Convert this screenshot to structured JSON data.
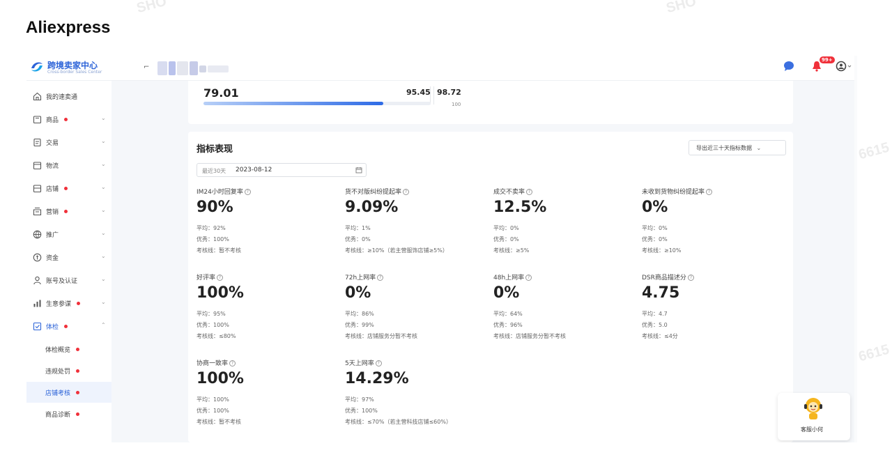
{
  "page": {
    "title": "Aliexpress"
  },
  "watermarks": [
    "SHO",
    "SHO",
    "6615",
    "6615"
  ],
  "topbar": {
    "logo_text": "跨境卖家中心",
    "logo_sub": "Cross-border Sales Center",
    "notification_badge": "99+"
  },
  "sidebar": {
    "items": [
      {
        "label": "我的速卖通",
        "dot": false,
        "chevron": ""
      },
      {
        "label": "商品",
        "dot": true,
        "chevron": "⌄"
      },
      {
        "label": "交易",
        "dot": false,
        "chevron": "⌄"
      },
      {
        "label": "物流",
        "dot": false,
        "chevron": "⌄"
      },
      {
        "label": "店铺",
        "dot": true,
        "chevron": "⌄"
      },
      {
        "label": "营销",
        "dot": true,
        "chevron": "⌄"
      },
      {
        "label": "推广",
        "dot": false,
        "chevron": "⌄"
      },
      {
        "label": "资金",
        "dot": false,
        "chevron": "⌄"
      },
      {
        "label": "账号及认证",
        "dot": false,
        "chevron": "⌄"
      },
      {
        "label": "生意参谋",
        "dot": true,
        "chevron": "⌄"
      },
      {
        "label": "体检",
        "dot": true,
        "chevron": "⌃"
      }
    ],
    "sub_items": [
      {
        "label": "体检概览",
        "dot": true,
        "active": false
      },
      {
        "label": "违规处罚",
        "dot": true,
        "active": false
      },
      {
        "label": "店铺考核",
        "dot": true,
        "active": true
      },
      {
        "label": "商品诊断",
        "dot": true,
        "active": false
      }
    ]
  },
  "score_card": {
    "score": "79.01",
    "mark_1": "95.45",
    "mark_2": "98.72",
    "bar_end_label": "100",
    "progress_fraction": 0.79
  },
  "metrics_card": {
    "title": "指标表现",
    "export_label": "导出近三十天指标数据",
    "date_label": "最近30天",
    "date_value": "2023-08-12",
    "metrics": [
      {
        "title": "IM24小时回复率",
        "value": "90%",
        "avg": "平均：92%",
        "good": "优秀：100%",
        "line": "考核线：暂不考核"
      },
      {
        "title": "货不对版纠纷提起率",
        "value": "9.09%",
        "avg": "平均：1%",
        "good": "优秀：0%",
        "line": "考核线：≥10%（若主营服饰店铺≥5%）"
      },
      {
        "title": "成交不卖率",
        "value": "12.5%",
        "avg": "平均：0%",
        "good": "优秀：0%",
        "line": "考核线：≥5%"
      },
      {
        "title": "未收到货物纠纷提起率",
        "value": "0%",
        "avg": "平均：0%",
        "good": "优秀：0%",
        "line": "考核线：≥10%"
      },
      {
        "title": "好评率",
        "value": "100%",
        "avg": "平均：95%",
        "good": "优秀：100%",
        "line": "考核线：≤80%"
      },
      {
        "title": "72h上网率",
        "value": "0%",
        "avg": "平均：86%",
        "good": "优秀：99%",
        "line": "考核线：店铺服务分暂不考核"
      },
      {
        "title": "48h上网率",
        "value": "0%",
        "avg": "平均：64%",
        "good": "优秀：96%",
        "line": "考核线：店铺服务分暂不考核"
      },
      {
        "title": "DSR商品描述分",
        "value": "4.75",
        "avg": "平均：4.7",
        "good": "优秀：5.0",
        "line": "考核线：≤4分"
      },
      {
        "title": "协商一致率",
        "value": "100%",
        "avg": "平均：100%",
        "good": "优秀：100%",
        "line": "考核线：暂不考核"
      },
      {
        "title": "5天上网率",
        "value": "14.29%",
        "avg": "平均：97%",
        "good": "优秀：100%",
        "line": "考核线：≤70%（若主营科技店铺≤60%）"
      }
    ]
  },
  "customer_service": {
    "label": "客服小何"
  },
  "colors": {
    "accent": "#2c63d8",
    "alert": "#f0303a"
  }
}
